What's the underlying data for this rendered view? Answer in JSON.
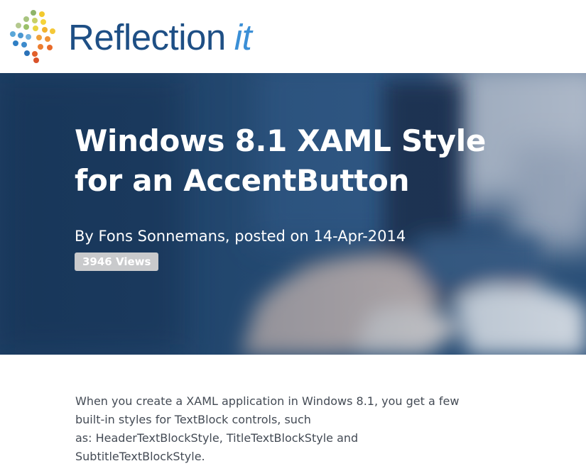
{
  "header": {
    "logo_text": "Reflection",
    "logo_suffix": "it",
    "logo_icon": "reflection-it-dots-logo"
  },
  "hero": {
    "title": "Windows 8.1 XAML Style for an AccentButton",
    "byline": "By Fons Sonnemans, posted on 14-Apr-2014",
    "views": "3946 Views"
  },
  "article": {
    "line1": "When you create a XAML application in Windows 8.1, you get a few",
    "line2": "built-in styles for TextBlock controls, such",
    "line3": "as: HeaderTextBlockStyle, TitleTextBlockStyle and SubtitleTextBlockStyle."
  },
  "colors": {
    "brand_blue": "#1e4f85",
    "brand_it": "#3b8fd6",
    "hero_bg": "#26517a",
    "badge_bg": "#c9cacc",
    "body_text": "#444b55"
  }
}
